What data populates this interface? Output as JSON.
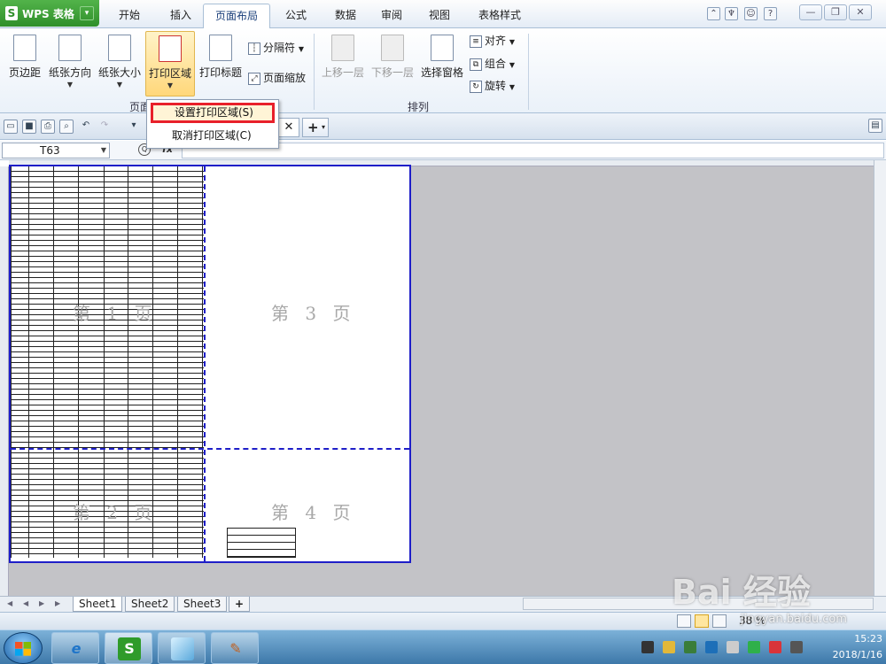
{
  "app": {
    "name": "WPS 表格"
  },
  "menu_tabs": [
    "开始",
    "插入",
    "页面布局",
    "公式",
    "数据",
    "审阅",
    "视图",
    "表格样式"
  ],
  "ribbon": {
    "buttons": [
      "页边距",
      "纸张方向",
      "纸张大小",
      "打印区域",
      "打印标题",
      "上移一层",
      "下移一层",
      "选择窗格"
    ],
    "separator_label": "分隔符",
    "page_scale_label": "页面缩放",
    "align_label": "对齐",
    "group_label": "组合",
    "rotate_label": "旋转",
    "group_page_label": "页面",
    "group_arrange_label": "排列"
  },
  "print_area_menu": {
    "items": [
      "设置打印区域(S)",
      "取消打印区域(C)"
    ],
    "highlight_color": "#e8202a"
  },
  "formula_bar": {
    "cell_ref": "T63",
    "fx": "fx"
  },
  "sheet": {
    "page_labels": [
      "第 1 页",
      "第 2 页",
      "第 3 页",
      "第 4 页"
    ],
    "page_border_color": "#1e1ec8"
  },
  "sheet_tabs": [
    "Sheet1",
    "Sheet2",
    "Sheet3"
  ],
  "status": {
    "zoom": "38 %"
  },
  "taskbar": {
    "time": "15:23",
    "date": "2018/1/16"
  },
  "watermark": {
    "brand": "Bai 经验",
    "url": "jingyan.baidu.com"
  }
}
